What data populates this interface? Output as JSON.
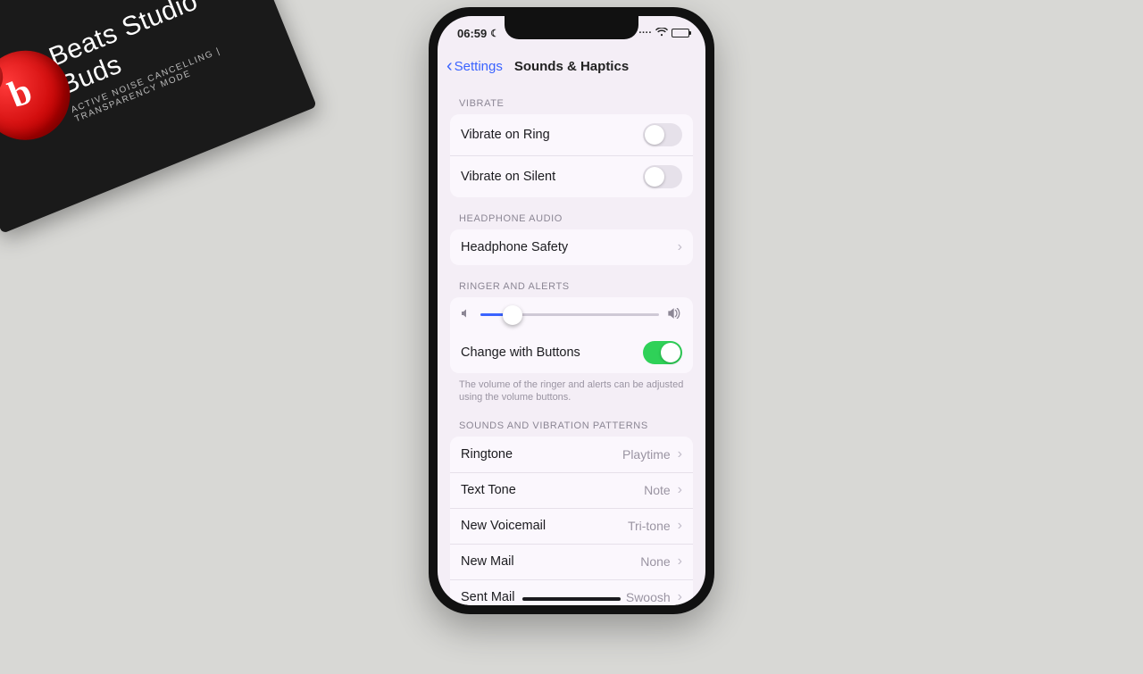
{
  "beats": {
    "title": "Beats Studio Buds",
    "sub": "ACTIVE NOISE CANCELLING   |   TRANSPARENCY MODE",
    "logo": "b"
  },
  "status": {
    "time": "06:59"
  },
  "nav": {
    "back": "Settings",
    "title": "Sounds & Haptics"
  },
  "vibrate": {
    "header": "VIBRATE",
    "ring": "Vibrate on Ring",
    "silent": "Vibrate on Silent"
  },
  "headphone": {
    "header": "HEADPHONE AUDIO",
    "safety": "Headphone Safety"
  },
  "ringer": {
    "header": "RINGER AND ALERTS",
    "change": "Change with Buttons",
    "footer": "The volume of the ringer and alerts can be adjusted using the volume buttons."
  },
  "patterns": {
    "header": "SOUNDS AND VIBRATION PATTERNS",
    "items": [
      {
        "label": "Ringtone",
        "value": "Playtime"
      },
      {
        "label": "Text Tone",
        "value": "Note"
      },
      {
        "label": "New Voicemail",
        "value": "Tri-tone"
      },
      {
        "label": "New Mail",
        "value": "None"
      },
      {
        "label": "Sent Mail",
        "value": "Swoosh"
      }
    ]
  }
}
